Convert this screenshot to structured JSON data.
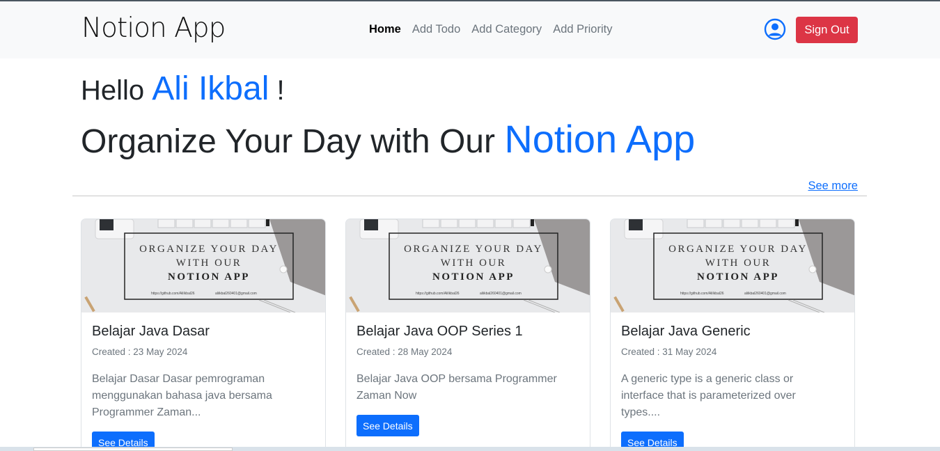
{
  "navbar": {
    "brand": "Notion App",
    "links": [
      {
        "label": "Home",
        "active": true
      },
      {
        "label": "Add Todo",
        "active": false
      },
      {
        "label": "Add Category",
        "active": false
      },
      {
        "label": "Add Priority",
        "active": false
      }
    ],
    "user_icon": "user-circle-icon",
    "signout_label": "Sign Out"
  },
  "hero": {
    "hello_prefix": "Hello",
    "user_name": "Ali Ikbal",
    "hello_suffix": "!",
    "tagline_prefix": "Organize Your Day with Our",
    "tagline_app": "Notion App"
  },
  "see_more": "See more",
  "banner": {
    "line1": "ORGANIZE YOUR DAY",
    "line2": "WITH OUR",
    "line3": "NOTION APP",
    "link1": "https://github.com/AliIkbal26",
    "link2": "aliikbal260401@gmail.com"
  },
  "cards": [
    {
      "title": "Belajar Java Dasar",
      "date": "Created : 23 May 2024",
      "text": "Belajar Dasar Dasar pemrograman menggunakan bahasa java bersama Programmer Zaman...",
      "button": "See Details"
    },
    {
      "title": "Belajar Java OOP Series 1",
      "date": "Created : 28 May 2024",
      "text": "Belajar Java OOP bersama Programmer Zaman Now",
      "button": "See Details"
    },
    {
      "title": "Belajar Java Generic",
      "date": "Created : 31 May 2024",
      "text": "A generic type is a generic class or interface that is parameterized over types....",
      "button": "See Details"
    }
  ],
  "colors": {
    "primary": "#0d6efd",
    "danger": "#dc3545",
    "navbar_bg": "#f8f9fa"
  }
}
